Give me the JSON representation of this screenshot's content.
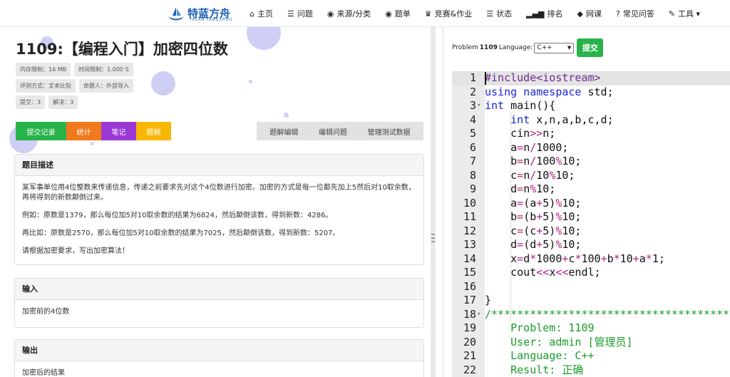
{
  "nav": {
    "logo_text": "特蓝方舟",
    "logo_sub": "TELAN FANGZHOU",
    "items": [
      {
        "icon": "home-icon",
        "glyph": "⌂",
        "label": "主页"
      },
      {
        "icon": "list-icon",
        "glyph": "☰",
        "label": "问题"
      },
      {
        "icon": "globe-icon",
        "glyph": "◉",
        "label": "来源/分类"
      },
      {
        "icon": "globe-icon",
        "glyph": "◉",
        "label": "题单"
      },
      {
        "icon": "trophy-icon",
        "glyph": "♛",
        "label": "竞赛&作业"
      },
      {
        "icon": "list-icon",
        "glyph": "☰",
        "label": "状态"
      },
      {
        "icon": "bar-chart-icon",
        "glyph": "▂▄▆",
        "label": "排名"
      },
      {
        "icon": "diamond-icon",
        "glyph": "◆",
        "label": "网课"
      },
      {
        "icon": "question-circle-icon",
        "glyph": "?",
        "label": "常见问答"
      },
      {
        "icon": "wrench-icon",
        "glyph": "✎",
        "label": "工具 ▾"
      }
    ]
  },
  "problem": {
    "title": "1109:【编程入门】加密四位数",
    "badges_row1": [
      "内存限制：16 MB",
      "时间限制：1.000 S"
    ],
    "badges_row2": [
      "评测方式：文本比较",
      "命题人：外部导入"
    ],
    "badges_row3": [
      "提交：3",
      "解决：3"
    ],
    "buttons": [
      {
        "label": "提交记录",
        "color": "#28b34a"
      },
      {
        "label": "统计",
        "color": "#f07a1b"
      },
      {
        "label": "笔记",
        "color": "#9b39d6"
      },
      {
        "label": "题解",
        "color": "#f9b705"
      }
    ],
    "admin_buttons": [
      "题解编辑",
      "编辑问题",
      "管理测试数据"
    ],
    "description_title": "题目描述",
    "description": [
      "某军事单位用4位整数来传递信息，传递之前要求先对这个4位数进行加密。加密的方式是每一位都先加上5然后对10取余数，再将得到的新数颠倒过来。",
      "例如：原数是1379，那么每位加5对10取余数的结果为6824，然后颠倒该数，得到新数：4286。",
      "再比如：原数是2570，那么每位加5对10取余数的结果为7025，然后颠倒该数，得到新数：5207。",
      "请根据加密要求，写出加密算法！"
    ],
    "input_title": "输入",
    "input_text": "加密前的4位数",
    "output_title": "输出",
    "output_text": "加密后的结果"
  },
  "submit_bar": {
    "problem_label": "Problem",
    "problem_id": "1109",
    "language_label": "Language:",
    "language_value": "C++",
    "submit_label": "提交"
  },
  "code_lines": [
    {
      "n": "1",
      "fold": false,
      "html": "<span class=\"pp\">#include&lt;iostream&gt;</span>"
    },
    {
      "n": "2",
      "fold": false,
      "html": "<span class=\"k\">using namespace</span> std;"
    },
    {
      "n": "3",
      "fold": true,
      "html": "<span class=\"k\">int</span> main(){"
    },
    {
      "n": "4",
      "fold": false,
      "html": "    <span class=\"k\">int</span> x,n,a,b,c,d;"
    },
    {
      "n": "5",
      "fold": false,
      "html": "    cin<span class=\"op\">&gt;&gt;</span>n;"
    },
    {
      "n": "6",
      "fold": false,
      "html": "    a<span class=\"op\">=</span>n<span class=\"op\">/</span>1000;"
    },
    {
      "n": "7",
      "fold": false,
      "html": "    b<span class=\"op\">=</span>n<span class=\"op\">/</span>100<span class=\"op\">%</span>10;"
    },
    {
      "n": "8",
      "fold": false,
      "html": "    c<span class=\"op\">=</span>n<span class=\"op\">/</span>10<span class=\"op\">%</span>10;"
    },
    {
      "n": "9",
      "fold": false,
      "html": "    d<span class=\"op\">=</span>n<span class=\"op\">%</span>10;"
    },
    {
      "n": "10",
      "fold": false,
      "html": "    a<span class=\"op\">=</span>(a<span class=\"op\">+</span>5)<span class=\"op\">%</span>10;"
    },
    {
      "n": "11",
      "fold": false,
      "html": "    b<span class=\"op\">=</span>(b<span class=\"op\">+</span>5)<span class=\"op\">%</span>10;"
    },
    {
      "n": "12",
      "fold": false,
      "html": "    c<span class=\"op\">=</span>(c<span class=\"op\">+</span>5)<span class=\"op\">%</span>10;"
    },
    {
      "n": "13",
      "fold": false,
      "html": "    d<span class=\"op\">=</span>(d<span class=\"op\">+</span>5)<span class=\"op\">%</span>10;"
    },
    {
      "n": "14",
      "fold": false,
      "html": "    x<span class=\"op\">=</span>d<span class=\"op\">*</span>1000<span class=\"op\">+</span>c<span class=\"op\">*</span>100<span class=\"op\">+</span>b<span class=\"op\">*</span>10<span class=\"op\">+</span>a<span class=\"op\">*</span>1;"
    },
    {
      "n": "15",
      "fold": false,
      "html": "    cout<span class=\"op\">&lt;&lt;</span>x<span class=\"op\">&lt;&lt;</span>endl;"
    },
    {
      "n": "16",
      "fold": false,
      "html": ""
    },
    {
      "n": "17",
      "fold": false,
      "html": "}"
    },
    {
      "n": "18",
      "fold": true,
      "html": "<span class=\"cm\">/**************************************************************</span>"
    },
    {
      "n": "19",
      "fold": false,
      "html": "<span class=\"cm\">    Problem: 1109</span>"
    },
    {
      "n": "20",
      "fold": false,
      "html": "<span class=\"cm\">    User: admin [管理员]</span>"
    },
    {
      "n": "21",
      "fold": false,
      "html": "<span class=\"cm\">    Language: C++</span>"
    },
    {
      "n": "22",
      "fold": false,
      "html": "<span class=\"cm\">    Result: 正确</span>"
    }
  ]
}
